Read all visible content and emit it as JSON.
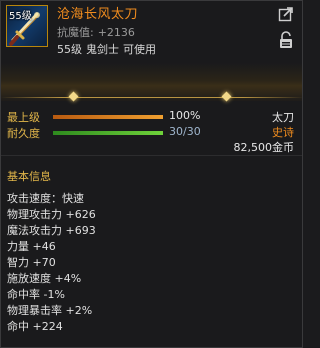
{
  "item": {
    "name": "沧海长风太刀",
    "level_badge": "55级",
    "anti_magic_label": "抗魔值:",
    "anti_magic_value": "+2136",
    "requirement": {
      "level": "55级",
      "class": "鬼剑士",
      "usable": "可使用"
    },
    "icon": "katana-sword-icon",
    "name_color": "#f08c1e"
  },
  "stats": {
    "max_level_label": "最上级",
    "max_level_value": "100%",
    "max_level_fill": 1.0,
    "durability_label": "耐久度",
    "durability_value": "30/30",
    "durability_fill": 1.0
  },
  "summary": {
    "type": "太刀",
    "rarity": "史诗",
    "rarity_color": "#f08c1e",
    "price": "82,500金币"
  },
  "basic_info": {
    "title": "基本信息",
    "attributes": [
      "攻击速度：快速",
      "物理攻击力 +626",
      "魔法攻击力 +693",
      "力量 +46",
      "智力 +70",
      "施放速度 +4%",
      "命中率 -1%",
      "物理暴击率 +2%",
      "命中 +224"
    ]
  },
  "header_icons": {
    "share": "share-icon",
    "lock": "lock-icon"
  }
}
